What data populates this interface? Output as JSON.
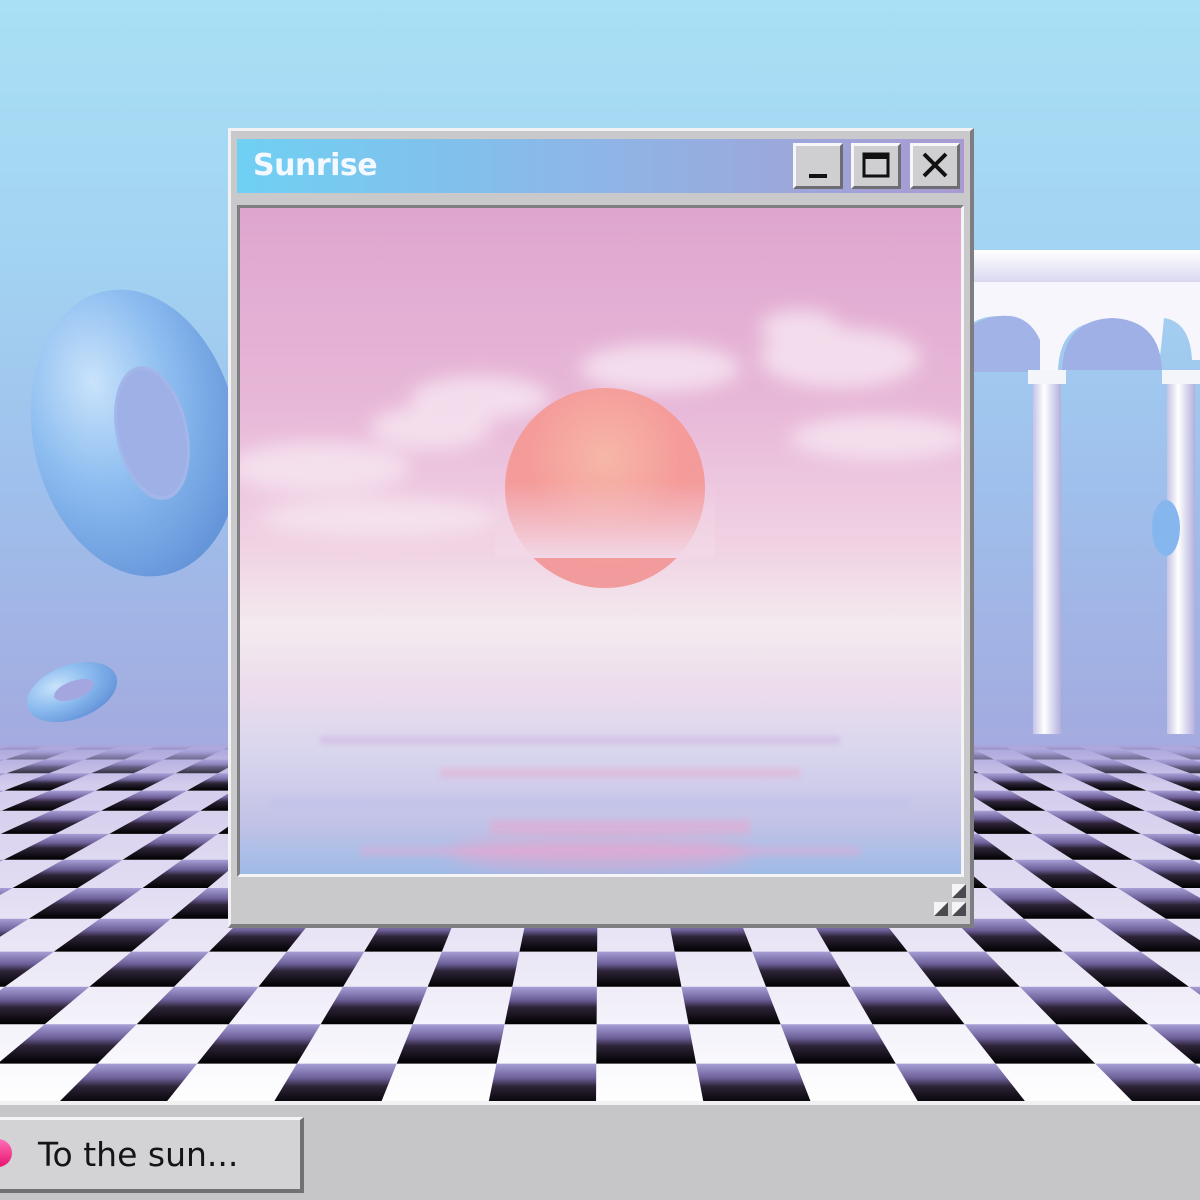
{
  "window": {
    "title": "Sunrise",
    "controls": {
      "minimize": "minimize-icon",
      "maximize": "maximize-icon",
      "close": "close-icon"
    }
  },
  "taskbar": {
    "task_label": "To the sun...",
    "task_icon": "sun-icon"
  },
  "colors": {
    "sky_top": "#a8def4",
    "sky_bottom": "#a7a6dc",
    "titlebar_start": "#6fd0f3",
    "titlebar_end": "#a99ad2",
    "sun": "#f49b9b",
    "window_frame": "#c9c9cc",
    "taskbar": "#c6c6c9",
    "torus": "#86b6ee"
  }
}
